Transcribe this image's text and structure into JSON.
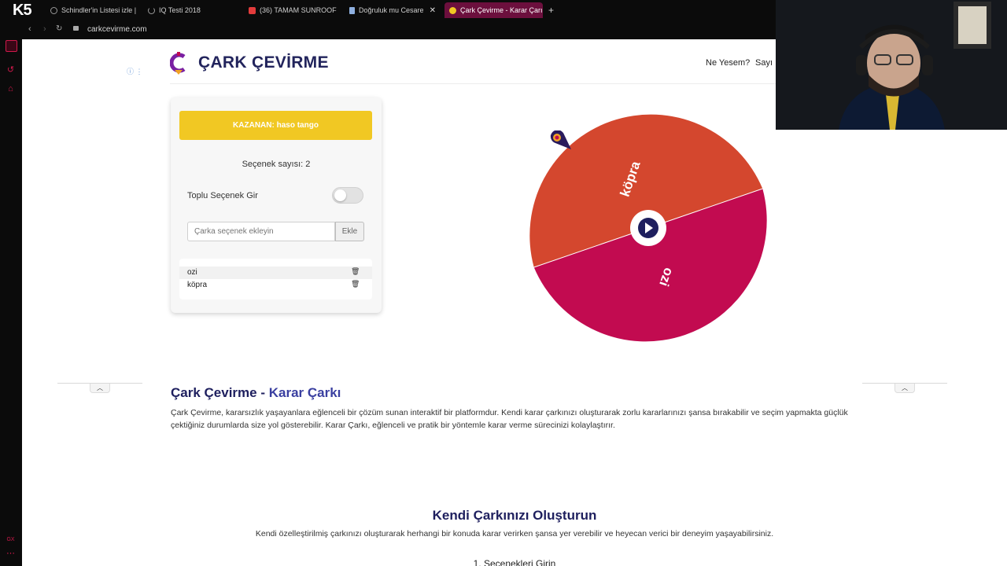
{
  "browser": {
    "tabs": [
      {
        "label": "Schindler'in Listesi izle | H",
        "icon_color": "#9a9a9a"
      },
      {
        "label": "IQ Testi 2018",
        "icon_color": "#9a9a9a"
      },
      {
        "label": "(36) TAMAM SUNROOF |",
        "icon_color": "#e23b3b"
      },
      {
        "label": "Doğruluk mu Cesaret",
        "icon_color": "#8fb0e0"
      },
      {
        "label": "Çark Çevirme - Karar Çarı",
        "icon_color": "#f1c823",
        "active": true
      }
    ],
    "new_tab_label": "+",
    "url": "carkcevirme.com",
    "overlay_logo": "K5",
    "sidebar_mark": "GX"
  },
  "header": {
    "logo_text": "ÇARK ÇEVİRME",
    "nav": [
      "Ne Yesem?",
      "Sayı"
    ]
  },
  "panel": {
    "winner_text": "KAZANAN: haso tango",
    "option_count_text": "Seçenek sayısı: 2",
    "bulk_label": "Toplu Seçenek Gir",
    "bulk_toggle_on": false,
    "input_placeholder": "Çarka seçenek ekleyin",
    "add_button": "Ekle",
    "options": [
      "ozi",
      "köpra"
    ]
  },
  "wheel": {
    "segments": [
      {
        "label": "köpra",
        "color": "#d4472e"
      },
      {
        "label": "ozi",
        "color": "#c20b50"
      }
    ],
    "center_button_icon": "play-icon",
    "pointer_icon": "pin-icon"
  },
  "info": {
    "title_main": "Çark Çevirme",
    "title_separator": " - ",
    "title_accent": "Karar Çarkı",
    "text": "Çark Çevirme, kararsızlık yaşayanlara eğlenceli bir çözüm sunan interaktif bir platformdur. Kendi karar çarkınızı oluşturarak zorlu kararlarınızı şansa bırakabilir ve seçim yapmakta güçlük çektiğiniz durumlarda size yol gösterebilir. Karar Çarkı, eğlenceli ve pratik bir yöntemle karar verme sürecinizi kolaylaştırır."
  },
  "create": {
    "title": "Kendi Çarkınızı Oluşturun",
    "text": "Kendi özelleştirilmiş çarkınızı oluşturarak herhangi bir konuda karar verirken şansa yer verebilir ve heyecan verici bir deneyim yaşayabilirsiniz.",
    "step1": "1. Seçenekleri Girin"
  },
  "colors": {
    "brand_navy": "#22245c",
    "winner_yellow": "#f1c823",
    "browser_accent": "#d0194b"
  }
}
